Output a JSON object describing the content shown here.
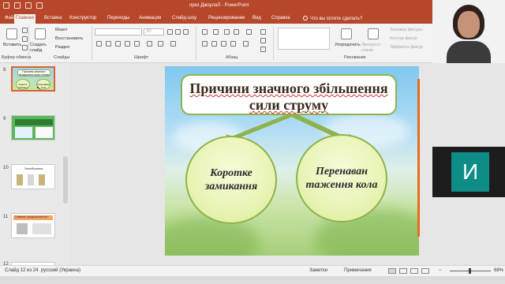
{
  "app": {
    "window_title": "през ДжоулаЛ  -  PowerPoint"
  },
  "tabs": [
    {
      "label": "Файл",
      "active": false
    },
    {
      "label": "Главная",
      "active": true
    },
    {
      "label": "Вставка",
      "active": false
    },
    {
      "label": "Конструктор",
      "active": false
    },
    {
      "label": "Переходы",
      "active": false
    },
    {
      "label": "Анимация",
      "active": false
    },
    {
      "label": "Слайд-шоу",
      "active": false
    },
    {
      "label": "Рецензирование",
      "active": false
    },
    {
      "label": "Вид",
      "active": false
    },
    {
      "label": "Справка",
      "active": false
    }
  ],
  "tell_me": "Что вы хотите сделать?",
  "ribbon": {
    "clipboard": {
      "paste": "Вставить",
      "label": "Буфер обмена"
    },
    "slides": {
      "new_slide": "Создать слайд",
      "layout": "Макет",
      "reset": "Восстановить",
      "section": "Раздел",
      "label": "Слайды"
    },
    "font": {
      "size": "30",
      "label": "Шрифт"
    },
    "paragraph": {
      "label": "Абзац"
    },
    "drawing": {
      "arrange": "Упорядочить",
      "quick_styles": "Экспресс-стили",
      "fill": "Заливка фигуры",
      "outline": "Контур фигур",
      "effects": "Эффекты фигур",
      "label": "Рисование"
    },
    "editing": {
      "find": "Найти",
      "replace": "Заменить",
      "select": "Выделить",
      "label": "Редактирование"
    }
  },
  "thumbnails": [
    {
      "num": "8",
      "title": "Причини значного збільшення сили струму",
      "b1": "Коротке замикання",
      "b2": "Перенавантаження кола"
    },
    {
      "num": "9"
    },
    {
      "num": "10",
      "title": "Запобіжники"
    },
    {
      "num": "11",
      "title": "Плавкие предохранители"
    },
    {
      "num": "12"
    }
  ],
  "slide": {
    "title_line1": "Причини значного збільшення",
    "title_line2": "сили струму",
    "bubble_left": "Коротке замикання",
    "bubble_right": "Перенаван таження кола"
  },
  "presenter": {
    "initial": "И"
  },
  "status": {
    "slide_of": "Слайд 12 из 24",
    "language": "русский (Украина)",
    "notes": "Заметки",
    "comments": "Примечания",
    "zoom": "68%"
  },
  "colors": {
    "accent": "#b7472a",
    "bubble_border": "#8fb24c",
    "title_text": "#3a2a1a",
    "presenter_tile": "#0e8c86"
  }
}
